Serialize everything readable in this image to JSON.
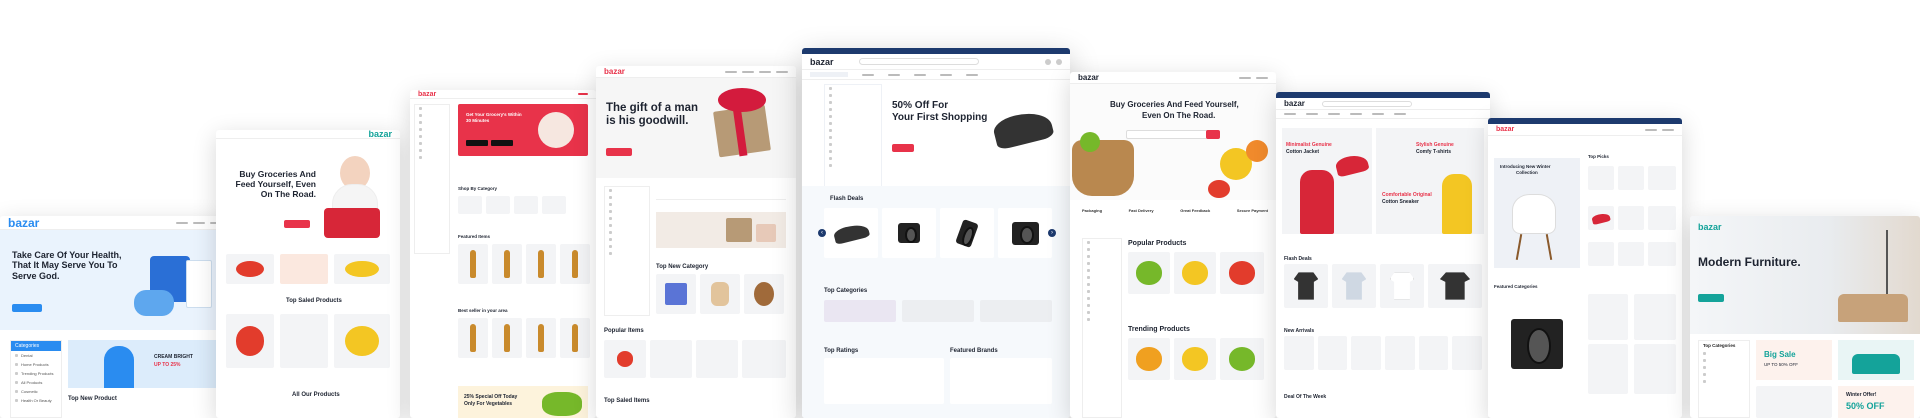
{
  "brand": {
    "logo": "bazar",
    "colors": {
      "red": "#e8334a",
      "blue": "#2a8cf0",
      "navy": "#1d3a6e",
      "teal": "#14a39a"
    }
  },
  "cards": {
    "health": {
      "headline": "Take Care Of Your Health, That It May Serve You To Serve God.",
      "section": "Top New Product",
      "badge_line1": "CREAM BRIGHT",
      "badge_line2": "UP TO 25%",
      "sidebar_title": "Categories",
      "sidebar_items": [
        "Dental",
        "Home Products",
        "Trending Products",
        "All Products",
        "Cosmetic",
        "Health Or Beauty"
      ]
    },
    "grocery_left": {
      "headline": "Buy Groceries And Feed Yourself, Even On The Road.",
      "section": "Top Saled Products",
      "section2": "All Our Products"
    },
    "grocery_sidebar": {
      "promo_title": "Get Your Grocery's Within 30 Minutes",
      "section": "Shop By Category",
      "section2": "Featured Items",
      "section3": "Best seller in your area",
      "promo2_line1": "25% Special Off Today",
      "promo2_line2": "Only For Vegetables"
    },
    "gift": {
      "headline": "The gift of a man is his goodwill.",
      "section": "Top New Category",
      "section2": "Popular Items",
      "section3": "Top Saled Items"
    },
    "center": {
      "headline_line1": "50% Off For",
      "headline_line2": "Your First Shopping",
      "section1": "Flash Deals",
      "section2": "Top Categories",
      "section3": "Top Ratings",
      "section4": "Featured Brands",
      "search_icon": "search-icon",
      "cart_icon": "cart-icon"
    },
    "produce": {
      "headline_line1": "Buy Groceries And Feed Yourself,",
      "headline_line2": "Even On The Road.",
      "section": "Popular Products",
      "section2": "Trending Products",
      "features": [
        "Packaging",
        "Fast Delivery",
        "Great Feedback",
        "Secure Payment"
      ]
    },
    "fashion": {
      "banner1_line1": "Minimalist Genuine",
      "banner1_line2": "Cotton Jacket",
      "banner2_line1": "Stylish Genuine",
      "banner2_line2": "Comfy T-shirts",
      "banner3_line1": "Comfortable Original",
      "banner3_line2": "Cotton Sneaker",
      "section": "Flash Deals",
      "section2": "New Arrivals",
      "section3": "Deal Of The Week"
    },
    "gadget": {
      "promo_line1": "Introducing New Winter",
      "promo_line2": "Collection",
      "section": "Top Picks",
      "section2": "Featured Categories"
    },
    "furniture": {
      "headline": "Modern Furniture.",
      "sale_line1": "Big Sale",
      "sale_line2": "UP TO 50% OFF",
      "sale2_line1": "Winter Offer!",
      "sale2_line2": "50% OFF",
      "section": "Top Categories"
    }
  }
}
